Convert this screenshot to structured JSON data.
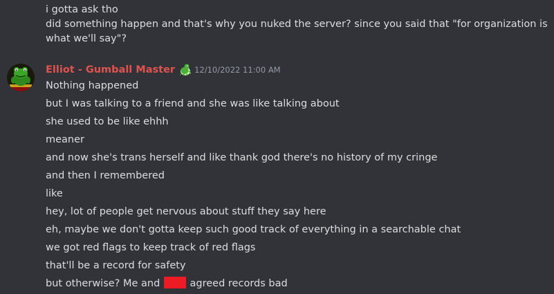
{
  "previous_message": {
    "lines": [
      "i gotta ask tho",
      "did something happen and that's why you nuked the server? since you said that  \"for organization is what we'll say\"?"
    ]
  },
  "message": {
    "username": "Elliot - Gumball Master",
    "username_color": "#e0524f",
    "role_icon": "green-dinosaur-icon",
    "timestamp": "12/10/2022 11:00 AM",
    "lines": [
      "Nothing happened",
      "but I was talking to a friend and she was like talking about",
      "she used to be like ehhh",
      "meaner",
      "and now she's trans herself and like thank god there's no history of my cringe",
      "and then I remembered",
      "like",
      "hey, lot of people get nervous about stuff they say here",
      "eh, maybe we don't gotta keep such good track of everything in a searchable chat",
      "we got red flags to keep track of red flags",
      "that'll be a record for safety"
    ],
    "last_line_before": "but otherwise? Me and ",
    "last_line_after": " agreed records bad"
  },
  "colors": {
    "background": "#313338",
    "text": "#dbdee1",
    "timestamp": "#949ba4",
    "redaction": "#ed1c24"
  }
}
